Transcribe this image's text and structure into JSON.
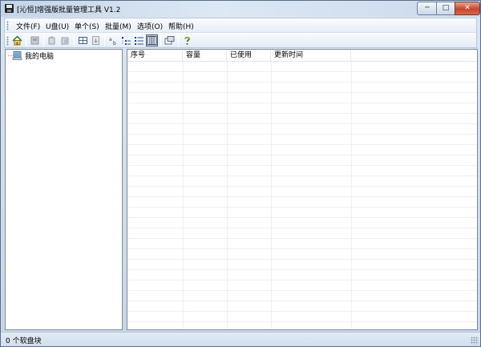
{
  "window": {
    "title": "[沁恒]增强版批量管理工具 V1.2"
  },
  "window_controls": {
    "minimize": "─",
    "maximize": "□",
    "close": "✕"
  },
  "menu": [
    {
      "label": "文件(F)"
    },
    {
      "label": "U盘(U)"
    },
    {
      "label": "单个(S)"
    },
    {
      "label": "批量(M)"
    },
    {
      "label": "选项(O)"
    },
    {
      "label": "帮助(H)"
    }
  ],
  "toolbar": {
    "icons": [
      "home-icon",
      "device-icon",
      "copy-icon",
      "paste-icon",
      "grid-icon",
      "export-icon",
      "sort-icon",
      "list-icon",
      "details-icon",
      "columns-icon",
      "window-icon",
      "help-icon"
    ]
  },
  "tree": {
    "root_label": "我的电脑"
  },
  "list": {
    "columns": [
      "序号",
      "容量",
      "已使用",
      "更新时间"
    ]
  },
  "status": {
    "text": "0 个软盘块"
  }
}
